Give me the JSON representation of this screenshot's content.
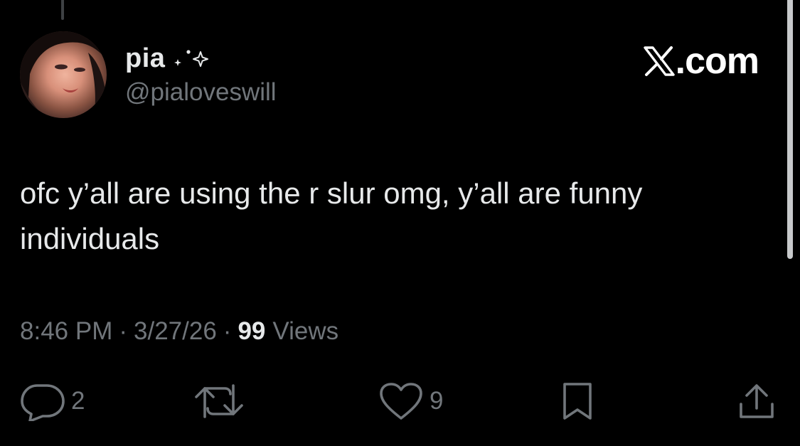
{
  "author": {
    "display_name": "pia",
    "handle": "@pialoveswill"
  },
  "brand": {
    "text": ".com"
  },
  "tweet": {
    "text": "ofc y’all are using the r slur omg, y’all are funny individuals"
  },
  "meta": {
    "time": "8:46 PM",
    "separator": "·",
    "date": "3/27/26",
    "views_count": "99",
    "views_label": "Views"
  },
  "actions": {
    "reply_count": "2",
    "like_count": "9"
  },
  "icons": {
    "avatar": "avatar",
    "name_decoration": "sparkle-icon",
    "brand": "x-logo-icon",
    "reply": "reply-icon",
    "retweet": "retweet-icon",
    "like": "heart-icon",
    "bookmark": "bookmark-icon",
    "share": "share-icon"
  },
  "colors": {
    "background": "#000000",
    "primary_text": "#e7e9ea",
    "secondary_text": "#71767b"
  }
}
